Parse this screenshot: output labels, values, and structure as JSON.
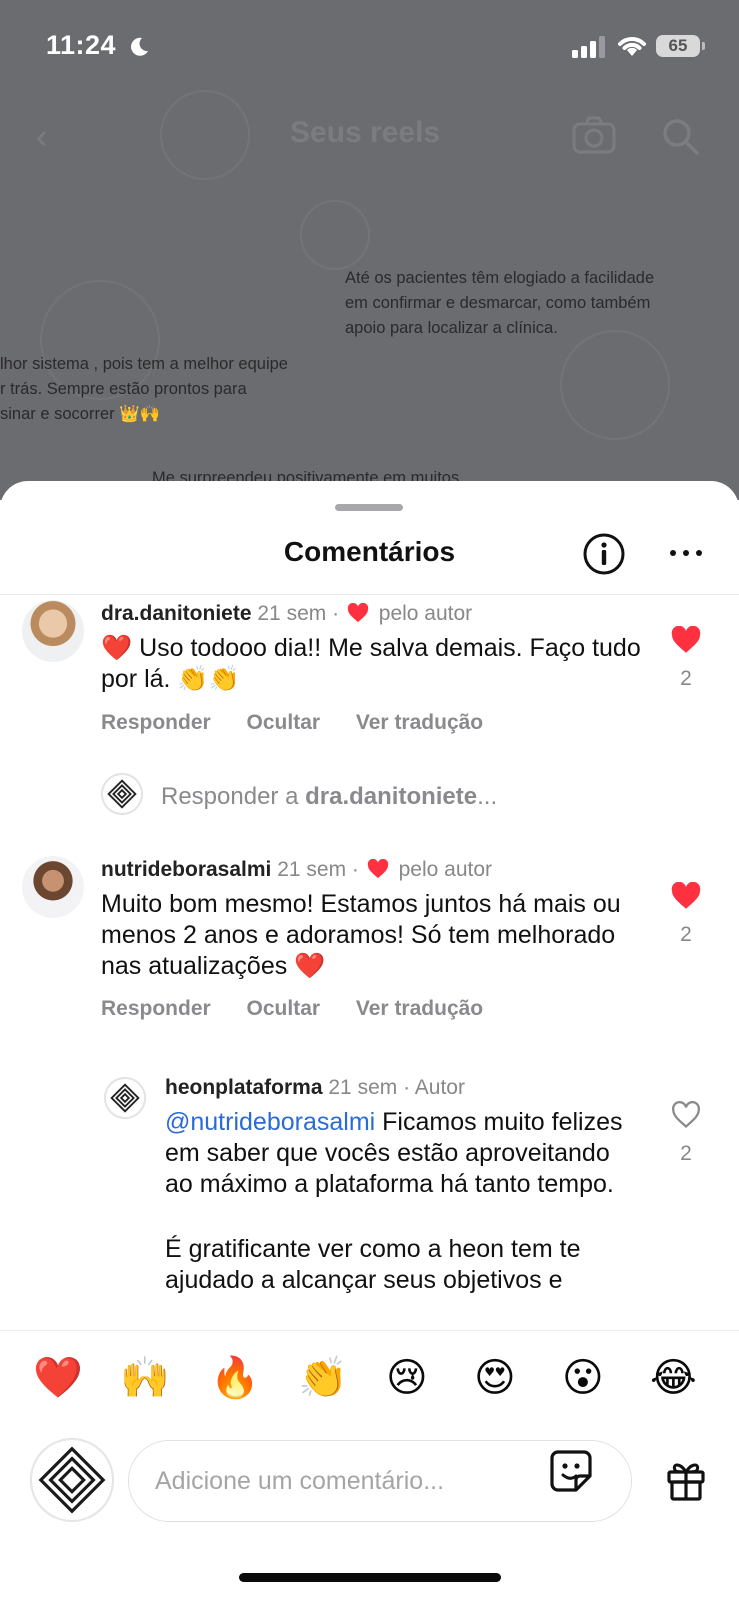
{
  "status": {
    "time": "11:24",
    "battery": "65"
  },
  "background": {
    "title": "Seus reels",
    "msg1": [
      "Até os pacientes têm elogiado a facilidade",
      "em confirmar e desmarcar, como também",
      "apoio para localizar a clínica."
    ],
    "msg2": [
      "lhor sistema , pois tem a melhor equipe",
      "r trás. Sempre estão prontos para",
      "sinar e socorrer 👑🙌"
    ],
    "msg3": "Me surpreendeu positivamente em muitos"
  },
  "sheet": {
    "title": "Comentários"
  },
  "comments": [
    {
      "user": "dra.danitoniete",
      "age": "21 sem",
      "liked_by_author": "pelo autor",
      "text": "❤️ Uso todooo dia!! Me salva demais. Faço tudo por lá. 👏👏",
      "likes": "2",
      "actions": [
        "Responder",
        "Ocultar",
        "Ver tradução"
      ]
    },
    {
      "user": "nutrideborasalmi",
      "age": "21 sem",
      "liked_by_author": "pelo autor",
      "text": "Muito bom mesmo! Estamos juntos há mais ou menos 2 anos e adoramos! Só tem melhorado nas atualizações ❤️",
      "likes": "2",
      "actions": [
        "Responder",
        "Ocultar",
        "Ver tradução"
      ]
    }
  ],
  "reply_prompt": {
    "prefix": "Responder a ",
    "user": "dra.danitoniete",
    "suffix": "..."
  },
  "reply": {
    "user": "heonplataforma",
    "age": "21 sem",
    "badge": "Autor",
    "mention": "@nutrideborasalmi",
    "text": " Ficamos muito felizes em saber que vocês estão aproveitando ao máximo a plataforma há tanto tempo.",
    "text2": "É gratificante ver como a heon tem te ajudado a alcançar seus objetivos e",
    "likes": "2"
  },
  "emoji_bar": [
    "❤️",
    "🙌",
    "🔥",
    "👏",
    "😢",
    "😍",
    "😮",
    "😂"
  ],
  "input": {
    "placeholder": "Adicione um comentário..."
  },
  "colors": {
    "like_red": "#ff3040",
    "mention_blue": "#2b6bd6",
    "dim_bg": "#6b6c70"
  }
}
